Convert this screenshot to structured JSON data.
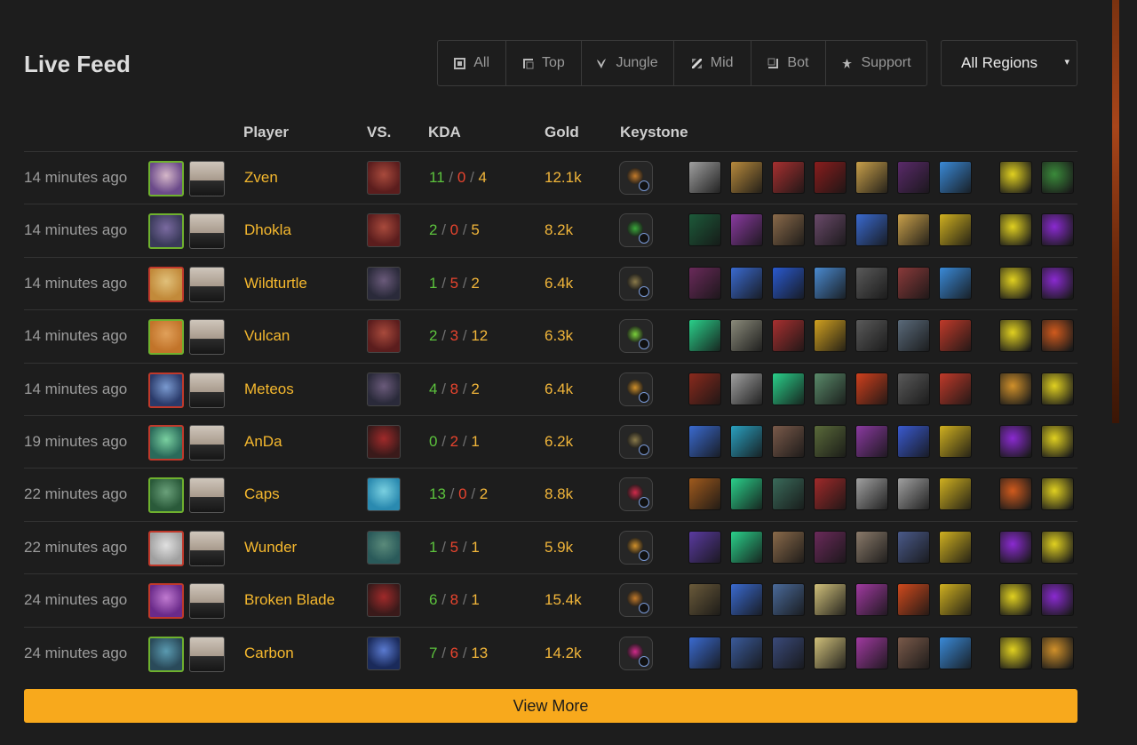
{
  "title": "Live Feed",
  "roles": [
    {
      "label": "All",
      "icon": "all-role-icon"
    },
    {
      "label": "Top",
      "icon": "top-role-icon"
    },
    {
      "label": "Jungle",
      "icon": "jungle-role-icon"
    },
    {
      "label": "Mid",
      "icon": "mid-role-icon"
    },
    {
      "label": "Bot",
      "icon": "bot-role-icon"
    },
    {
      "label": "Support",
      "icon": "support-role-icon"
    }
  ],
  "region": {
    "selected": "All Regions",
    "caret": "▾"
  },
  "headers": {
    "player": "Player",
    "vs": "VS.",
    "kda": "KDA",
    "gold": "Gold",
    "keystone": "Keystone"
  },
  "kda_separator": "/",
  "rows": [
    {
      "time": "14 minutes ago",
      "player": "Zven",
      "k": "11",
      "d": "0",
      "a": "4",
      "gold": "12.1k",
      "border": "green",
      "champ": [
        "#6b4a8a",
        "#d5b7c8"
      ],
      "vs": [
        "#5b1d1d",
        "#a84a3c"
      ],
      "key": "#c27a2a",
      "items": [
        "#a0a0a0",
        "#b88a3c",
        "#a83030",
        "#8a1d1d",
        "#c9a04a",
        "#5a2a6a",
        "#3a8ad8"
      ],
      "spells": [
        "#e0d020",
        "#3a8a3a"
      ]
    },
    {
      "time": "14 minutes ago",
      "player": "Dhokla",
      "k": "2",
      "d": "0",
      "a": "5",
      "gold": "8.2k",
      "border": "green",
      "champ": [
        "#3a3a5a",
        "#7a6aa0"
      ],
      "vs": [
        "#5b1d1d",
        "#a84a3c"
      ],
      "key": "#3aa83a",
      "items": [
        "#1d5a3a",
        "#8a3aa0",
        "#8a6a4a",
        "#6a4a6a",
        "#3a6ad0",
        "#c9a04a",
        "#d0b020"
      ],
      "spells": [
        "#e0d020",
        "#8a2ad0"
      ]
    },
    {
      "time": "14 minutes ago",
      "player": "Wildturtle",
      "k": "1",
      "d": "5",
      "a": "2",
      "gold": "6.4k",
      "border": "red",
      "champ": [
        "#c28a3a",
        "#e0c07a"
      ],
      "vs": [
        "#2a2a3a",
        "#6a5a7a"
      ],
      "key": "#8a7a4a",
      "items": [
        "#6a2a5a",
        "#3a6ad0",
        "#2a5ad0",
        "#4a8ad0",
        "#5a5a5a",
        "#8a3a3a",
        "#3a8ad8"
      ],
      "spells": [
        "#e0d020",
        "#8a2ad0"
      ]
    },
    {
      "time": "14 minutes ago",
      "player": "Vulcan",
      "k": "2",
      "d": "3",
      "a": "12",
      "gold": "6.3k",
      "border": "green",
      "champ": [
        "#c2742a",
        "#e0a05a"
      ],
      "vs": [
        "#5b1d1d",
        "#a84a3c"
      ],
      "key": "#7ad03a",
      "items": [
        "#2ad08a",
        "#8a8a7a",
        "#a83030",
        "#d0a020",
        "#5a5a5a",
        "#5a6a7a",
        "#c03a2a"
      ],
      "spells": [
        "#e0d020",
        "#d05a1d"
      ]
    },
    {
      "time": "14 minutes ago",
      "player": "Meteos",
      "k": "4",
      "d": "8",
      "a": "2",
      "gold": "6.4k",
      "border": "red",
      "champ": [
        "#2a3a6a",
        "#7a9ad0"
      ],
      "vs": [
        "#2a2a3a",
        "#6a5a7a"
      ],
      "key": "#d0902a",
      "items": [
        "#8a2a1d",
        "#a0a0a0",
        "#2ad08a",
        "#5a8a6a",
        "#d0401d",
        "#5a5a5a",
        "#c03a2a"
      ],
      "spells": [
        "#d0902a",
        "#e0d020"
      ]
    },
    {
      "time": "19 minutes ago",
      "player": "AnDa",
      "k": "0",
      "d": "2",
      "a": "1",
      "gold": "6.2k",
      "border": "red",
      "champ": [
        "#2a6a5a",
        "#7ad0a0"
      ],
      "vs": [
        "#3a1a1a",
        "#a02a2a"
      ],
      "key": "#8a7a4a",
      "items": [
        "#3a6ad0",
        "#2aa0c0",
        "#7a5a4a",
        "#5a6a3a",
        "#8a3aa0",
        "#3a5ad0",
        "#d0b020"
      ],
      "spells": [
        "#8a2ad0",
        "#e0d020"
      ]
    },
    {
      "time": "22 minutes ago",
      "player": "Caps",
      "k": "13",
      "d": "0",
      "a": "2",
      "gold": "8.8k",
      "border": "green",
      "champ": [
        "#2a5a3a",
        "#6aa07a"
      ],
      "vs": [
        "#2a8ab0",
        "#7ad0e0"
      ],
      "key": "#d02a4a",
      "items": [
        "#a05a1d",
        "#2ad08a",
        "#3a6a5a",
        "#a02a2a",
        "#a0a0a0",
        "#a0a0a0",
        "#d0b020"
      ],
      "spells": [
        "#d05a1d",
        "#e0d020"
      ]
    },
    {
      "time": "22 minutes ago",
      "player": "Wunder",
      "k": "1",
      "d": "5",
      "a": "1",
      "gold": "5.9k",
      "border": "red",
      "champ": [
        "#a0a0a0",
        "#e0e0e0"
      ],
      "vs": [
        "#2a5a5a",
        "#5a8a7a"
      ],
      "key": "#d0902a",
      "items": [
        "#5a3aa0",
        "#2ad08a",
        "#8a6a4a",
        "#6a2a5a",
        "#8a7a6a",
        "#4a5a8a",
        "#d0b020"
      ],
      "spells": [
        "#8a2ad0",
        "#e0d020"
      ]
    },
    {
      "time": "24 minutes ago",
      "player": "Broken Blade",
      "k": "6",
      "d": "8",
      "a": "1",
      "gold": "15.4k",
      "border": "red",
      "champ": [
        "#6a2a8a",
        "#c07ad0"
      ],
      "vs": [
        "#3a1a1a",
        "#a02a2a"
      ],
      "key": "#c27a2a",
      "items": [
        "#6a5a3a",
        "#3a6ad0",
        "#4a6a9a",
        "#d0c07a",
        "#a03aa0",
        "#d04a1d",
        "#d0b020"
      ],
      "spells": [
        "#e0d020",
        "#8a2ad0"
      ]
    },
    {
      "time": "24 minutes ago",
      "player": "Carbon",
      "k": "7",
      "d": "6",
      "a": "13",
      "gold": "14.2k",
      "border": "green",
      "champ": [
        "#2a4a5a",
        "#5a9ab0"
      ],
      "vs": [
        "#1a2a5a",
        "#5a7ad0"
      ],
      "key": "#d02a8a",
      "items": [
        "#3a6ad0",
        "#3a5a9a",
        "#3a4a7a",
        "#d0c07a",
        "#a03aa0",
        "#7a5a4a",
        "#3a8ad8"
      ],
      "spells": [
        "#e0d020",
        "#d0902a"
      ]
    }
  ],
  "view_more": "View More"
}
